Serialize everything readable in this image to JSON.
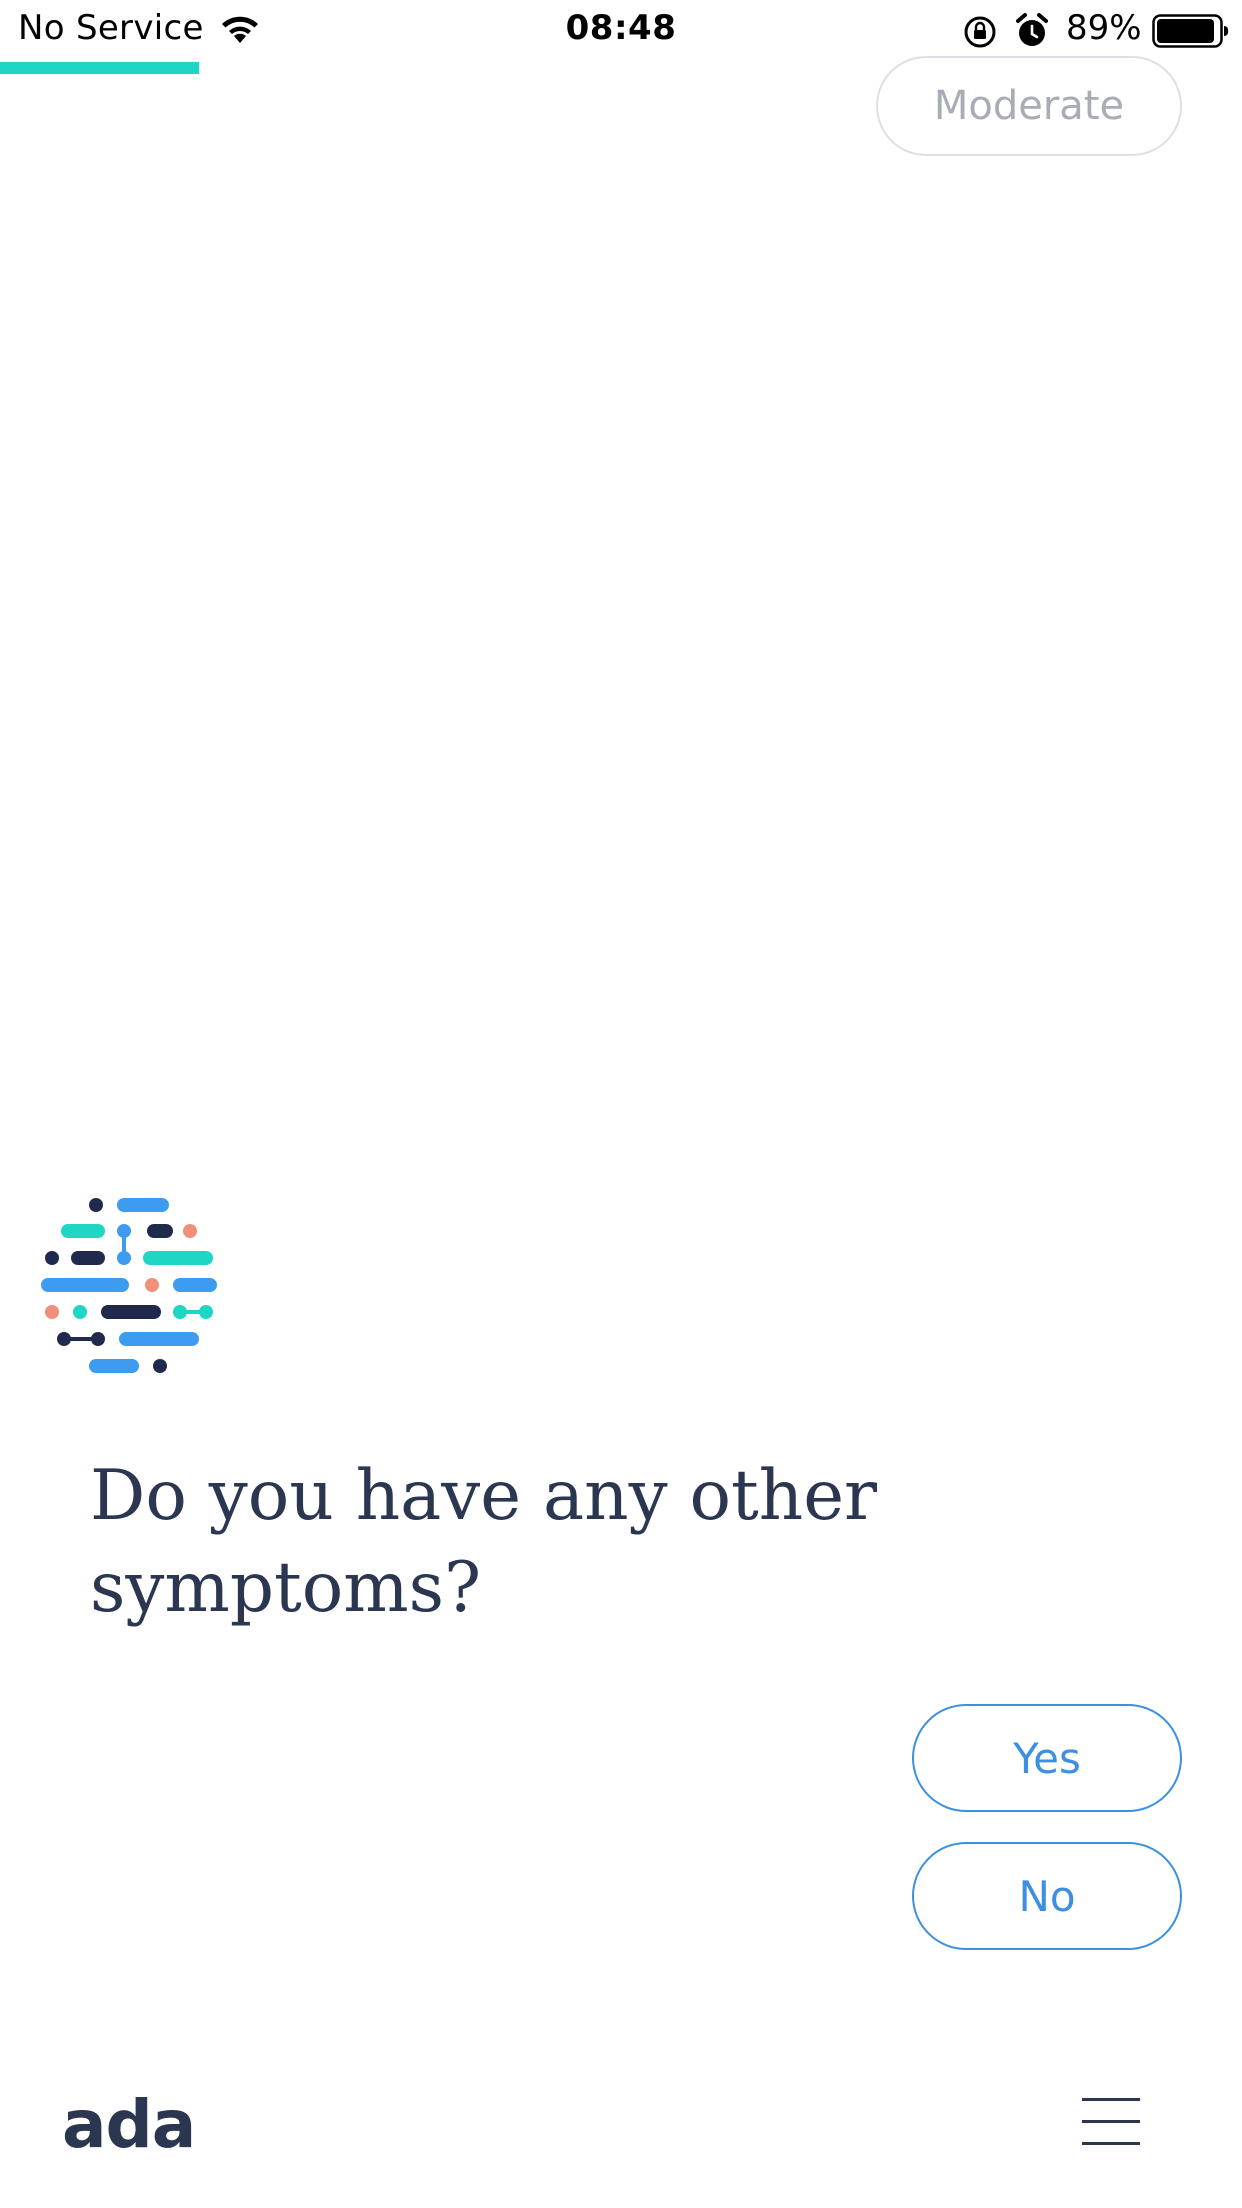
{
  "status_bar": {
    "carrier": "No Service",
    "time": "08:48",
    "battery_percent": "89%"
  },
  "progress": {
    "fraction": 0.16,
    "color": "#1fd6c4"
  },
  "previous_answer": {
    "label": "Moderate"
  },
  "question": {
    "text": "Do you have any other symptoms?"
  },
  "answers": {
    "yes_label": "Yes",
    "no_label": "No"
  },
  "footer": {
    "logo_text": "ada",
    "menu_icon": "hamburger-menu-icon"
  },
  "colors": {
    "brand_dark": "#2b3651",
    "accent_blue": "#3d8fe0",
    "accent_teal": "#1fd6c4",
    "accent_coral": "#f0907a"
  }
}
